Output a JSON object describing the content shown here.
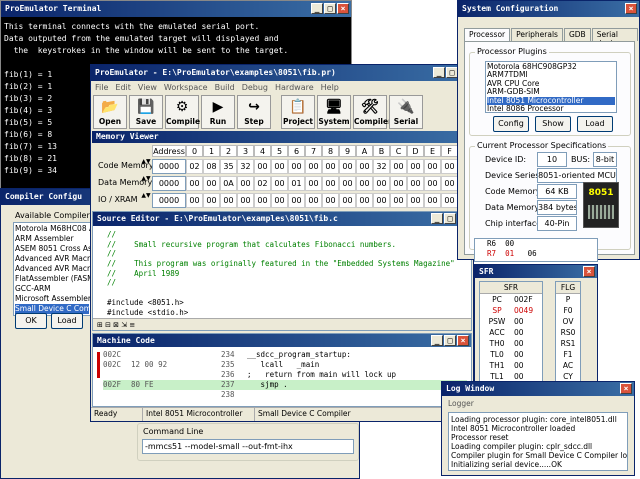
{
  "terminal": {
    "title": "ProEmulator Terminal",
    "lines": [
      "This terminal connects with the emulated serial port.",
      "Data outputed from the emulated target will displayed and",
      "  the  keystrokes in the window will be sent to the target."
    ],
    "fib": [
      "fib(1) = 1",
      "fib(2) = 1",
      "fib(3) = 2",
      "fib(4) = 3",
      "fib(5) = 5",
      "fib(6) = 8",
      "fib(7) = 13",
      "fib(8) = 21",
      "fib(9) = 34"
    ]
  },
  "main": {
    "title": "ProEmulator - E:\\ProEmulator\\examples\\8051\\fib.pr)",
    "menu": [
      "File",
      "Edit",
      "View",
      "Workspace",
      "Build",
      "Debug",
      "Hardware",
      "Help"
    ],
    "toolbar": [
      "Open",
      "Save",
      "Compile",
      "Run",
      "Step",
      "Project",
      "System",
      "Compiler",
      "Serial"
    ]
  },
  "memory": {
    "title": "Memory Viewer",
    "header": [
      "Address",
      "0",
      "1",
      "2",
      "3",
      "4",
      "5",
      "6",
      "7",
      "8",
      "9",
      "A",
      "B",
      "C",
      "D",
      "E",
      "F"
    ],
    "rows": [
      {
        "label": "Code Memory",
        "addr": "0000",
        "cells": [
          "02",
          "08",
          "35",
          "32",
          "00",
          "00",
          "00",
          "00",
          "00",
          "00",
          "00",
          "32",
          "00",
          "00",
          "00",
          "00"
        ]
      },
      {
        "label": "Data Memory",
        "addr": "0000",
        "cells": [
          "00",
          "00",
          "0A",
          "00",
          "02",
          "00",
          "01",
          "00",
          "00",
          "00",
          "00",
          "00",
          "00",
          "00",
          "00",
          "00"
        ]
      },
      {
        "label": "IO / XRAM",
        "addr": "0000",
        "cells": [
          "00",
          "00",
          "00",
          "00",
          "00",
          "00",
          "00",
          "00",
          "00",
          "00",
          "00",
          "00",
          "00",
          "00",
          "00",
          "00"
        ]
      }
    ]
  },
  "source": {
    "title": "Source Editor - E:\\ProEmulator\\examples\\8051\\fib.c",
    "lines": [
      {
        "t": "//",
        "c": "cm"
      },
      {
        "t": "//    Small recursive program that calculates Fibonacci numbers.",
        "c": "cm"
      },
      {
        "t": "//",
        "c": "cm"
      },
      {
        "t": "//    This program was originally featured in the \"Embedded Systems Magazine\"",
        "c": "cm"
      },
      {
        "t": "//    April 1989",
        "c": "cm"
      },
      {
        "t": "//",
        "c": "cm"
      },
      {
        "t": "",
        "c": ""
      },
      {
        "t": "#include <8051.h>",
        "c": "inc"
      },
      {
        "t": "#include <stdio.h>",
        "c": "inc"
      }
    ]
  },
  "machine": {
    "title": "Machine Code",
    "rows": [
      {
        "addr": "002C",
        "bytes": "",
        "line": "234",
        "src": "__sdcc_program_startup:",
        "hl": false
      },
      {
        "addr": "002C",
        "bytes": "12 00 92",
        "line": "235",
        "src": "   lcall   _main",
        "hl": false
      },
      {
        "addr": "",
        "bytes": "",
        "line": "236",
        "src": ";   return from main will lock up",
        "hl": false
      },
      {
        "addr": "002F",
        "bytes": "80 FE",
        "line": "237",
        "src": "   sjmp .",
        "hl": true
      },
      {
        "addr": "",
        "bytes": "",
        "line": "238",
        "src": "",
        "hl": false
      }
    ]
  },
  "status": {
    "ready": "Ready",
    "cpu": "Intel 8051 Microcontroller",
    "compiler": "Small Device C Compiler"
  },
  "compiler_cfg": {
    "title": "Compiler Configu",
    "available": "Available Compilers",
    "items": [
      "Motorola M68HC08 Asse",
      "ARM Assembler",
      "ASEM 8051 Cross Asse",
      "Advanced AVR Macro A",
      "Advanced AVR Macro A",
      "FlatAssembler (FASM)",
      "GCC-ARM",
      "Microsoft Assembler (M",
      "Small Device C Compile"
    ],
    "ok": "OK",
    "load": "Load",
    "cmd_label": "Command Line",
    "cmd": "-mmcs51 --model-small --out-fmt-ihx"
  },
  "syscfg": {
    "title": "System Configuration",
    "tabs": [
      "Processor",
      "Peripherals",
      "GDB",
      "Serial device"
    ],
    "plugins_label": "Processor Plugins",
    "plugins": [
      "Motorola 68HC908GP32",
      "ARM7TDMI",
      "AVR CPU Core",
      "ARM-GDB-SIM",
      "Intel 8051 Microcontroller",
      "Intel 8086 Processor"
    ],
    "config": "Config",
    "show": "Show",
    "load": "Load",
    "spec_label": "Current Processor Specifications",
    "device_id_l": "Device ID:",
    "device_id": "10",
    "bus_l": "BUS:",
    "bus": "8-bit",
    "series_l": "Device Series:",
    "series": "8051-oriented MCU",
    "code_l": "Code Memory:",
    "code": "64 KB",
    "data_l": "Data Memory:",
    "data": "384 bytes",
    "chip_l": "Chip interface:",
    "chip": "40-Pin",
    "chip_logo": "8051"
  },
  "regs": {
    "r6": "R6",
    "r6v": "00",
    "r7": "R7",
    "r7v": "01",
    "r7x": "06"
  },
  "sfr": {
    "title": "SFR",
    "head": "SFR",
    "rows": [
      {
        "n": "PC",
        "v": "002F"
      },
      {
        "n": "SP",
        "v": "0049"
      },
      {
        "n": "PSW",
        "v": "00"
      },
      {
        "n": "ACC",
        "v": "00"
      },
      {
        "n": "TH0",
        "v": "00"
      },
      {
        "n": "TL0",
        "v": "00"
      },
      {
        "n": "TH1",
        "v": "00"
      },
      {
        "n": "TL1",
        "v": "00"
      },
      {
        "n": "IE",
        "v": "00"
      }
    ],
    "flg": "FLG",
    "flags": [
      "P",
      "F0",
      "OV",
      "RS0",
      "RS1",
      "F1",
      "AC",
      "CY"
    ]
  },
  "log": {
    "title": "Log Window",
    "tab": "Logger",
    "lines": [
      "Loading processor plugin: core_intel8051.dll",
      "Intel 8051 Microcontroller loaded",
      "Processor reset",
      "Loading compiler plugin: cplr_sdcc.dll",
      "Compiler plugin for Small Device C Compiler loaded",
      "Initializing serial device.....OK"
    ]
  }
}
